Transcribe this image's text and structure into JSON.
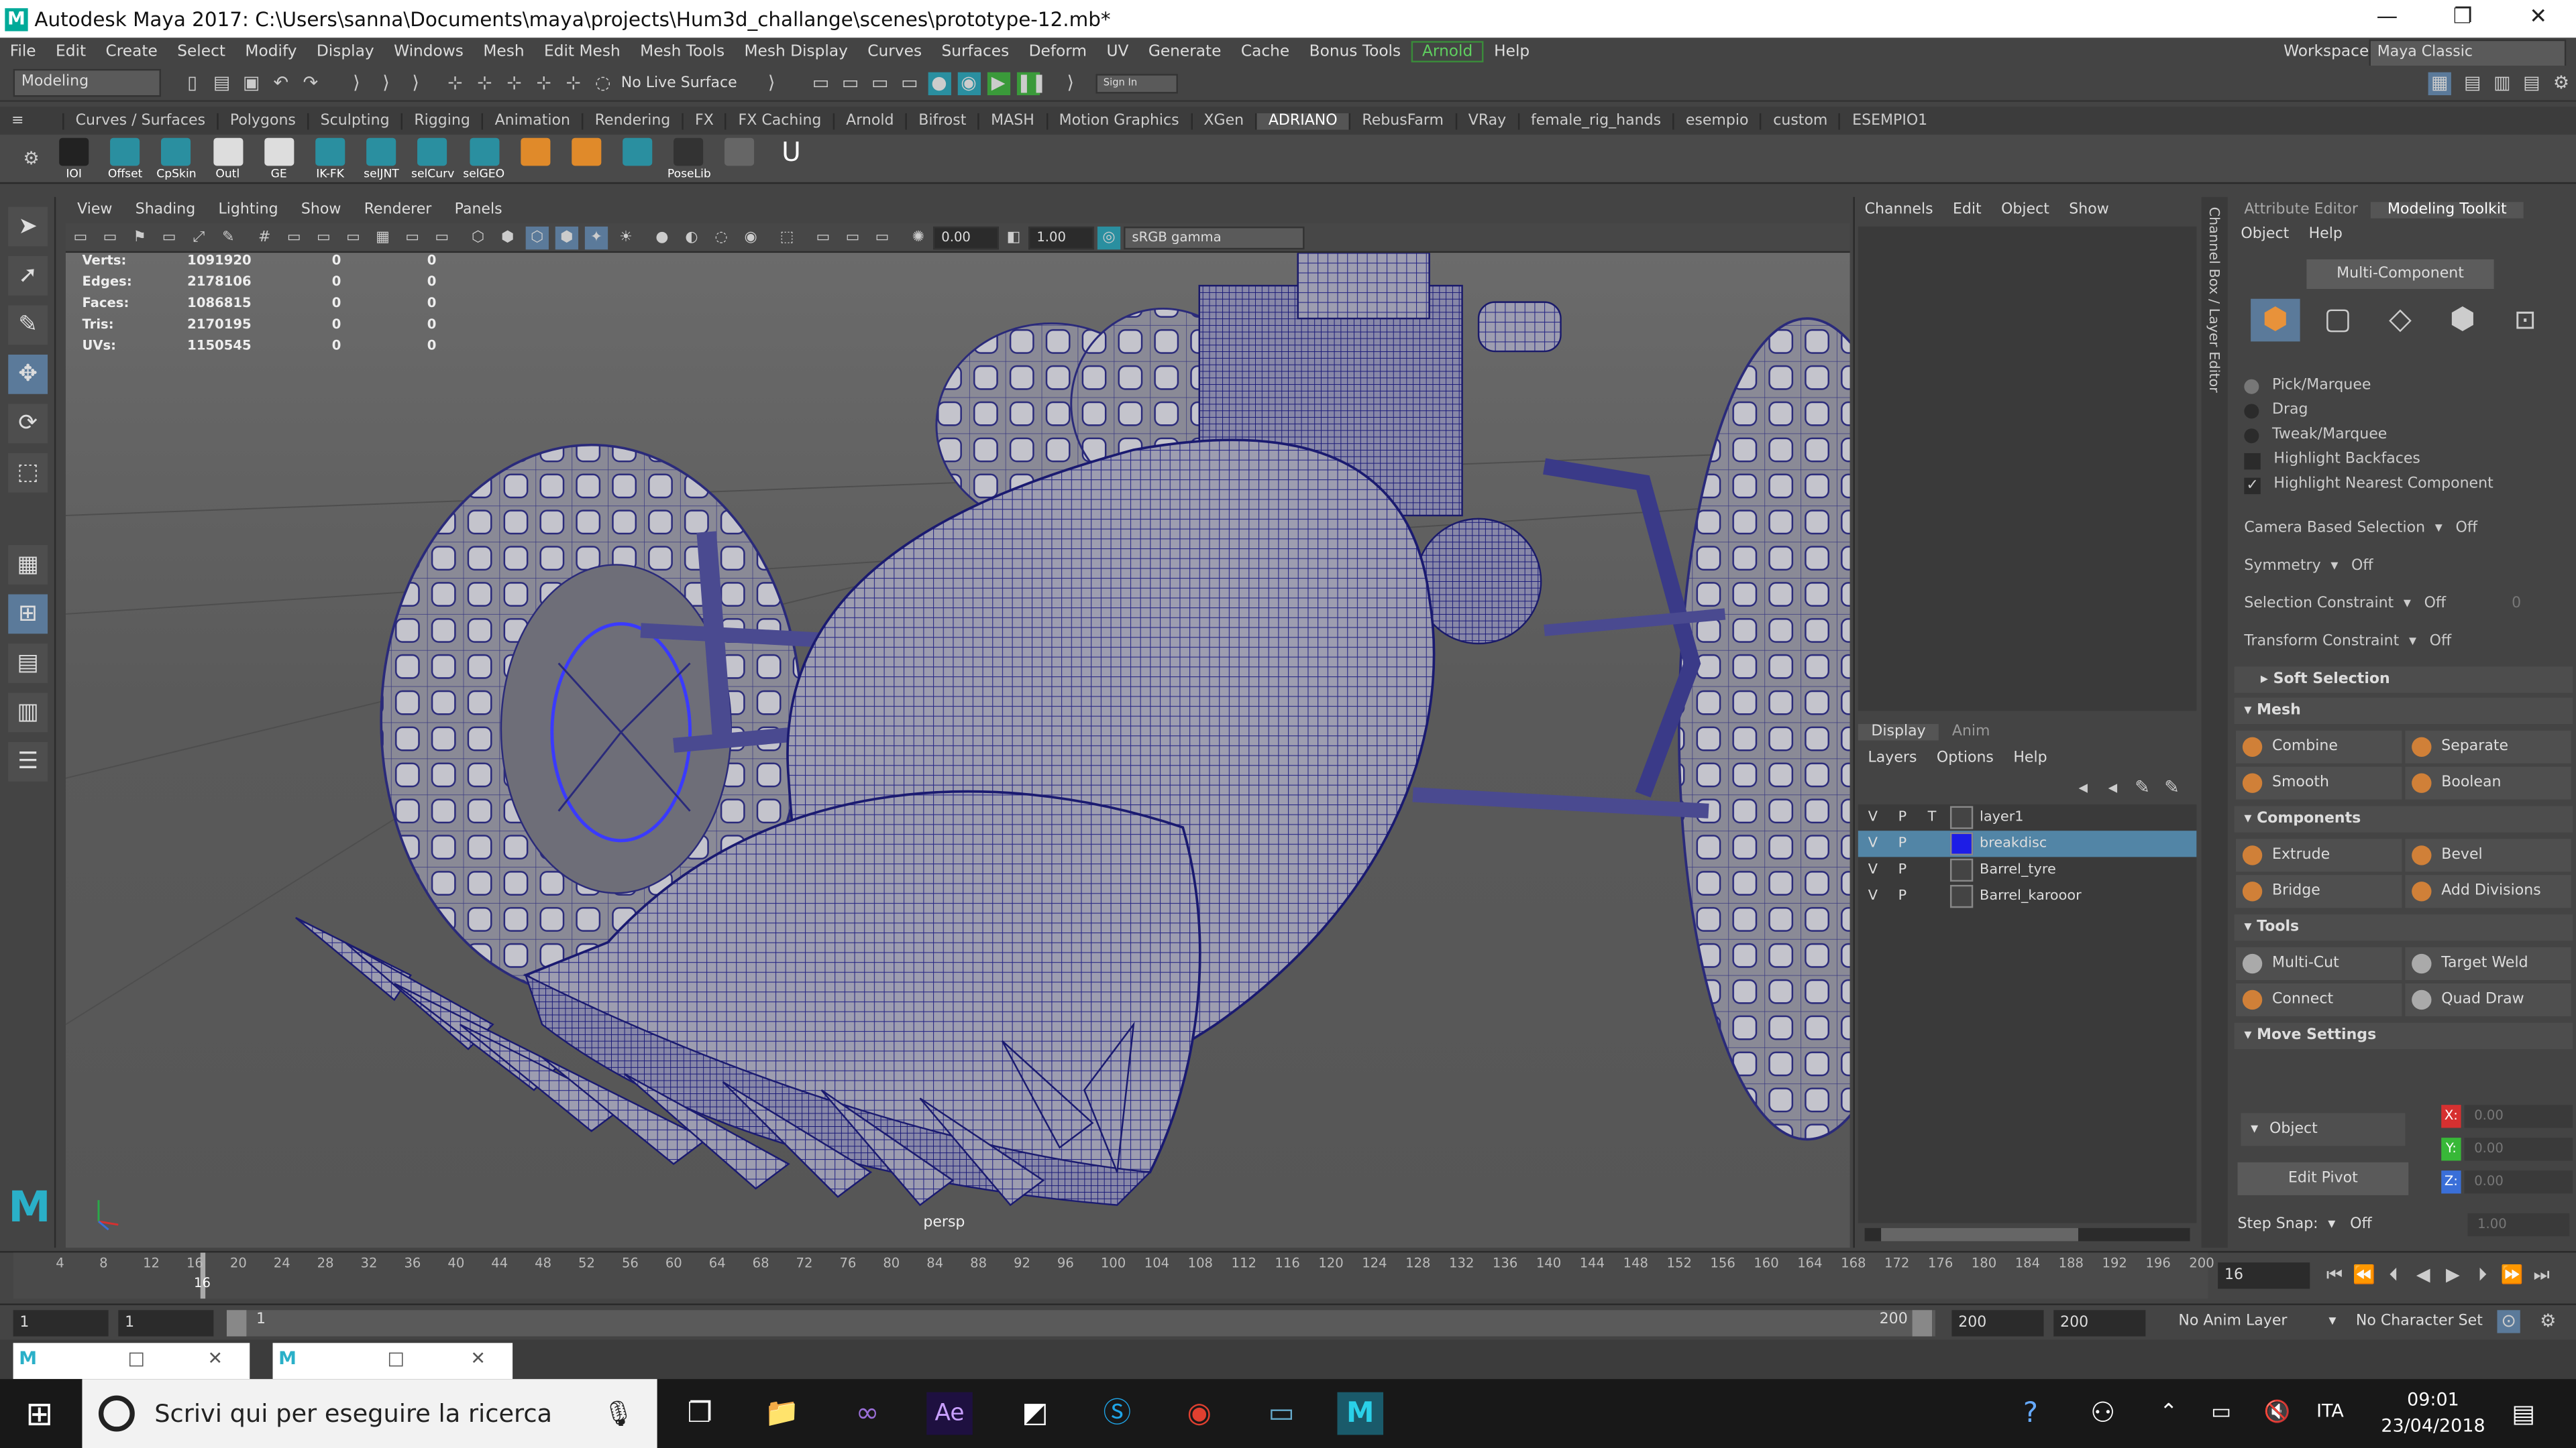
{
  "window": {
    "title": "Autodesk Maya 2017: C:\\Users\\sanna\\Documents\\maya\\projects\\Hum3d_challange\\scenes\\prototype-12.mb*",
    "logo_letter": "M",
    "controls": [
      "—",
      "❐",
      "✕"
    ]
  },
  "menubar": {
    "items": [
      "File",
      "Edit",
      "Create",
      "Select",
      "Modify",
      "Display",
      "Windows",
      "Mesh",
      "Edit Mesh",
      "Mesh Tools",
      "Mesh Display",
      "Curves",
      "Surfaces",
      "Deform",
      "UV",
      "Generate",
      "Cache",
      "Bonus Tools",
      "Arnold",
      "Help"
    ],
    "workspace_label": "Workspace :",
    "workspace_value": "Maya Classic"
  },
  "statusline": {
    "mode": "Modeling",
    "live_surface": "No Live Surface",
    "sign_in": "Sign In"
  },
  "shelf": {
    "tabs": [
      "Curves / Surfaces",
      "Polygons",
      "Sculpting",
      "Rigging",
      "Animation",
      "Rendering",
      "FX",
      "FX Caching",
      "Arnold",
      "Bifrost",
      "MASH",
      "Motion Graphics",
      "XGen",
      "ADRIANO",
      "RebusFarm",
      "VRay",
      "female_rig_hands",
      "esempio",
      "custom",
      "ESEMPIO1"
    ],
    "active_tab": "ADRIANO",
    "buttons": [
      "IOI",
      "Offset",
      "CpSkin",
      "Outl",
      "GE",
      "IK-FK",
      "selJNT",
      "selCurv",
      "selGEO",
      "",
      "",
      "",
      "PoseLib",
      "",
      ""
    ]
  },
  "viewport": {
    "menu": [
      "View",
      "Shading",
      "Lighting",
      "Show",
      "Renderer",
      "Panels"
    ],
    "near_value": "0.00",
    "far_value": "1.00",
    "color_space": "sRGB gamma",
    "camera_label": "persp",
    "hud": [
      {
        "label": "Verts:",
        "v1": "1091920",
        "v2": "0",
        "v3": "0"
      },
      {
        "label": "Edges:",
        "v1": "2178106",
        "v2": "0",
        "v3": "0"
      },
      {
        "label": "Faces:",
        "v1": "1086815",
        "v2": "0",
        "v3": "0"
      },
      {
        "label": "Tris:",
        "v1": "2170195",
        "v2": "0",
        "v3": "0"
      },
      {
        "label": "UVs:",
        "v1": "1150545",
        "v2": "0",
        "v3": "0"
      }
    ]
  },
  "channel_box": {
    "menu": [
      "Channels",
      "Edit",
      "Object",
      "Show"
    ],
    "vertical_tab": "Channel Box / Layer Editor",
    "layer_tabs": [
      "Display",
      "Anim"
    ],
    "layer_menu": [
      "Layers",
      "Options",
      "Help"
    ],
    "layers": [
      {
        "v": "V",
        "p": "P",
        "t": "T",
        "name": "layer1",
        "color": "#444444",
        "selected": false
      },
      {
        "v": "V",
        "p": "P",
        "t": "",
        "name": "breakdisc",
        "color": "#1d1de6",
        "selected": true
      },
      {
        "v": "V",
        "p": "P",
        "t": "",
        "name": "Barrel_tyre",
        "color": "#444444",
        "selected": false
      },
      {
        "v": "V",
        "p": "P",
        "t": "",
        "name": "Barrel_karooor",
        "color": "#444444",
        "selected": false
      }
    ]
  },
  "modeling_toolkit": {
    "tabs": [
      "Attribute Editor",
      "Modeling Toolkit"
    ],
    "menu": [
      "Object",
      "Help"
    ],
    "multi_component": "Multi-Component",
    "pick_options": [
      "Pick/Marquee",
      "Drag",
      "Tweak/Marquee"
    ],
    "checks": [
      {
        "label": "Highlight Backfaces",
        "checked": false
      },
      {
        "label": "Highlight Nearest Component",
        "checked": true
      }
    ],
    "settings": [
      {
        "label": "Camera Based Selection",
        "value": "Off"
      },
      {
        "label": "Symmetry",
        "value": "Off"
      },
      {
        "label": "Selection Constraint",
        "value": "Off",
        "extra": "0"
      },
      {
        "label": "Transform Constraint",
        "value": "Off"
      }
    ],
    "soft_selection": "Soft Selection",
    "mesh_header": "Mesh",
    "mesh_buttons": [
      "Combine",
      "Separate",
      "Smooth",
      "Boolean"
    ],
    "components_header": "Components",
    "components_buttons": [
      "Extrude",
      "Bevel",
      "Bridge",
      "Add Divisions"
    ],
    "tools_header": "Tools",
    "tools_buttons": [
      "Multi-Cut",
      "Target Weld",
      "Connect",
      "Quad Draw"
    ],
    "move_header": "Move Settings",
    "move_space": "Object",
    "edit_pivot": "Edit Pivot",
    "axes": [
      {
        "axis": "X:",
        "value": "0.00",
        "color": "#d63030"
      },
      {
        "axis": "Y:",
        "value": "0.00",
        "color": "#38b838"
      },
      {
        "axis": "Z:",
        "value": "0.00",
        "color": "#3a6fd8"
      }
    ],
    "step_snap_label": "Step Snap:",
    "step_snap_value": "Off",
    "step_snap_number": "1.00"
  },
  "timeline": {
    "ticks": [
      "4",
      "8",
      "12",
      "16",
      "20",
      "24",
      "28",
      "32",
      "36",
      "40",
      "44",
      "48",
      "52",
      "56",
      "60",
      "64",
      "68",
      "72",
      "76",
      "80",
      "84",
      "88",
      "92",
      "96",
      "100",
      "104",
      "108",
      "112",
      "116",
      "120",
      "124",
      "128",
      "132",
      "136",
      "140",
      "144",
      "148",
      "152",
      "156",
      "160",
      "164",
      "168",
      "172",
      "176",
      "180",
      "184",
      "188",
      "192",
      "196",
      "200"
    ],
    "current_marker": "16",
    "current_frame": "16"
  },
  "range": {
    "start": "1",
    "start2": "1",
    "slider_start": "1",
    "slider_end": "200",
    "end1": "200",
    "end2": "200",
    "anim_layer": "No Anim Layer",
    "character_set": "No Character Set"
  },
  "taskbar": {
    "search_placeholder": "Scrivi qui per eseguire la ricerca",
    "language": "ITA",
    "time": "09:01",
    "date": "23/04/2018"
  }
}
